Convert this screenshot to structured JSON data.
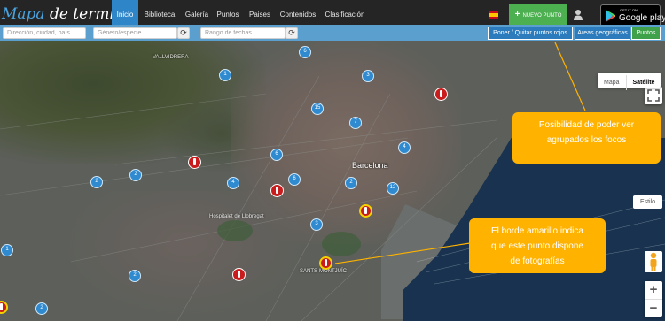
{
  "brand": {
    "part1": "Mapa",
    "part2": " de termitas"
  },
  "nav": {
    "items": [
      {
        "label": "Inicio",
        "active": true
      },
      {
        "label": "Biblioteca"
      },
      {
        "label": "Galería"
      },
      {
        "label": "Puntos"
      },
      {
        "label": "Paises"
      },
      {
        "label": "Contenidos"
      },
      {
        "label": "Clasificación"
      }
    ]
  },
  "new_point_label": "NUEVO PUNTO",
  "google_play": {
    "small": "GET IT ON",
    "big": "Google play"
  },
  "filters": {
    "address_placeholder": "Dirección, ciudad, país...",
    "genus_placeholder": "Género/especie",
    "date_placeholder": "Rango de fechas"
  },
  "filter_buttons": {
    "toggle_red": "Poner / Quitar puntos rojos",
    "areas": "Areas geográficas",
    "points": "Puntos"
  },
  "map": {
    "type_map": "Mapa",
    "type_satellite": "Satélite",
    "style": "Estilo",
    "zoom_in": "+",
    "zoom_out": "−",
    "labels": {
      "city": "Barcelona",
      "vallvidrera": "VALLVIDRERA",
      "hospitalet": "Hospitalet de Llobregat",
      "sants": "SANTS-MONTJUÏC"
    },
    "clusters": [
      "6",
      "1",
      "3",
      "15",
      "7",
      "6",
      "4",
      "2",
      "2",
      "6",
      "4",
      "2",
      "12",
      "3",
      "1",
      "2",
      "2"
    ]
  },
  "callouts": {
    "grouping": [
      "Posibilidad de poder ver",
      "agrupados los focos"
    ],
    "photos": [
      "El borde amarillo indica",
      "que este punto dispone",
      "de fotografías"
    ]
  },
  "colors": {
    "navbar": "#252525",
    "accent": "#2e86c9",
    "green": "#4caf50",
    "callout": "#ffb300",
    "pin": "#c91d1d",
    "photo_border": "#f6d100"
  }
}
